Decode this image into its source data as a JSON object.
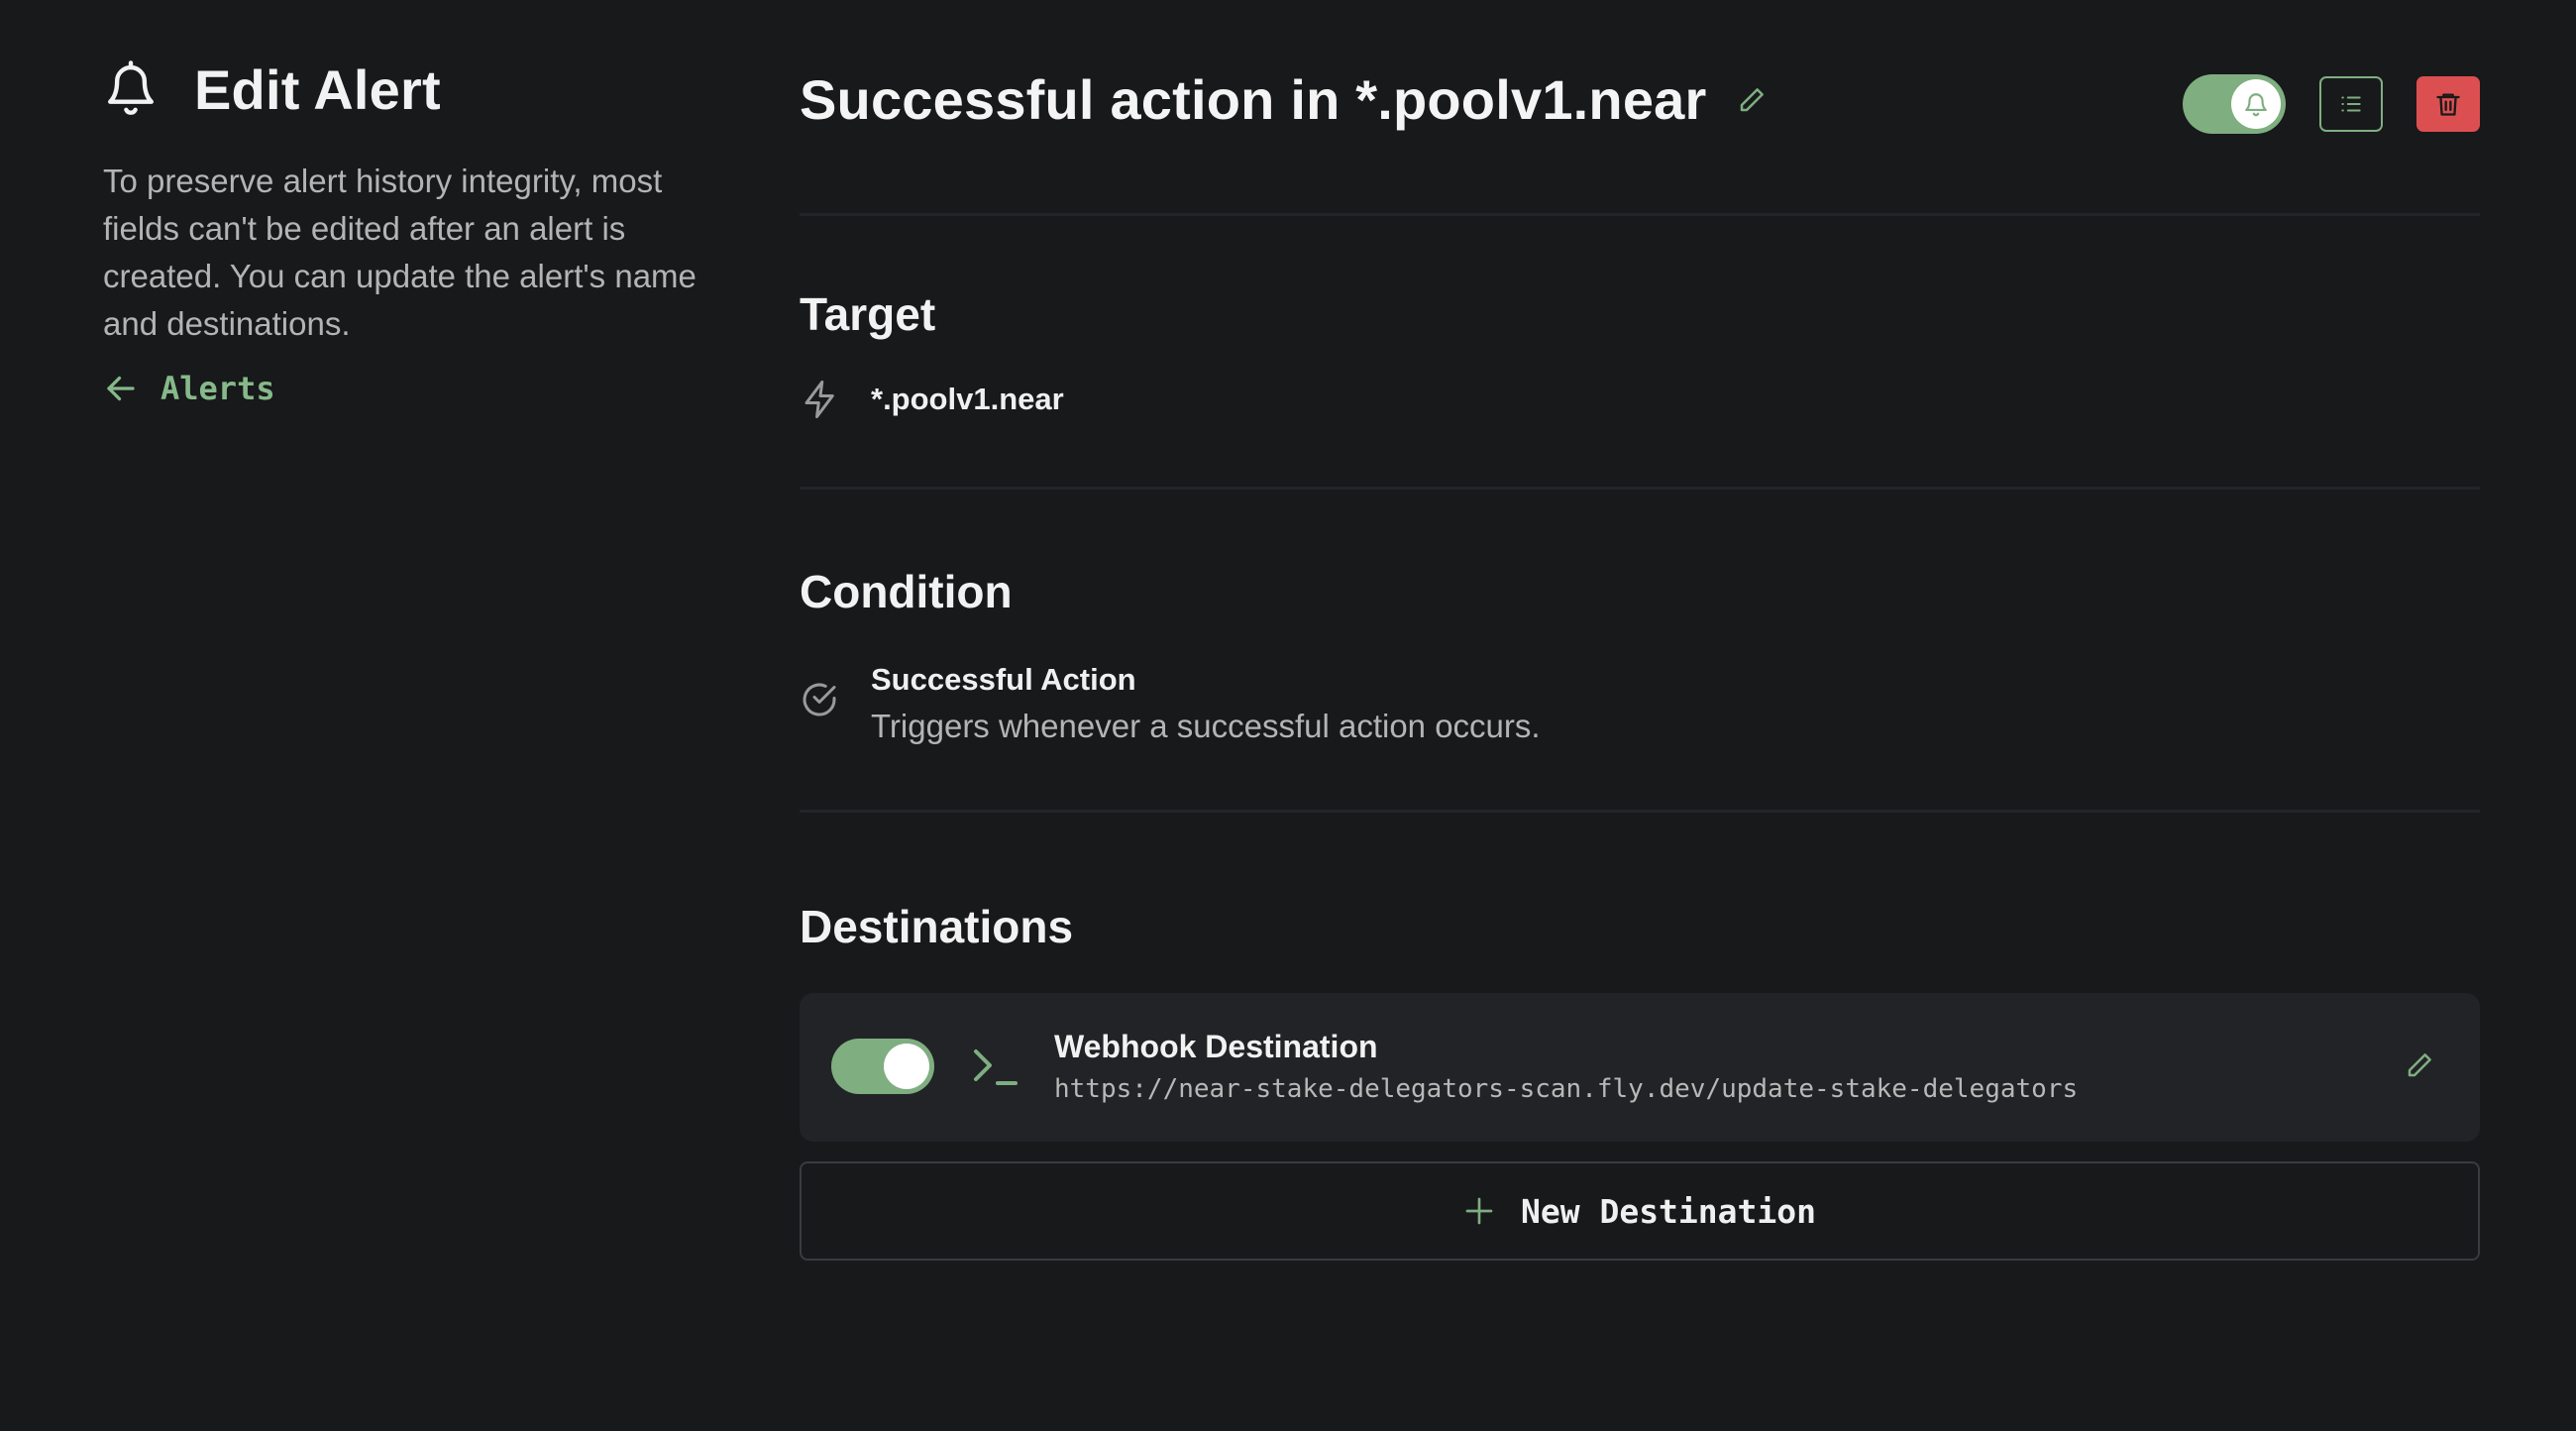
{
  "colors": {
    "background": "#18191b",
    "accent": "#7fae81",
    "danger": "#dc4f51",
    "card": "#222326",
    "muted_text": "#b4b4b4"
  },
  "sidebar": {
    "icon": "bell-icon",
    "title": "Edit Alert",
    "description": "To preserve alert history integrity, most fields can't be edited after an alert is created. You can update the alert's name and destinations.",
    "back_link": {
      "icon": "arrow-left-icon",
      "label": "Alerts"
    }
  },
  "header": {
    "alert_name": "Successful action in *.poolv1.near",
    "edit_icon": "pencil-icon",
    "actions": {
      "alert_enabled": true,
      "toggle_icon": "bell-icon",
      "logs_icon": "list-icon",
      "delete_icon": "trash-icon"
    }
  },
  "target": {
    "title": "Target",
    "icon": "lightning-icon",
    "value": "*.poolv1.near"
  },
  "condition": {
    "title": "Condition",
    "icon": "check-circle-icon",
    "label": "Successful Action",
    "description": "Triggers whenever a successful action occurs."
  },
  "destinations": {
    "title": "Destinations",
    "items": [
      {
        "enabled": true,
        "icon": "terminal-icon",
        "name": "Webhook Destination",
        "url": "https://near-stake-delegators-scan.fly.dev/update-stake-delegators",
        "edit_icon": "pencil-icon"
      }
    ],
    "new_button": {
      "icon": "plus-icon",
      "label": "New Destination"
    }
  }
}
